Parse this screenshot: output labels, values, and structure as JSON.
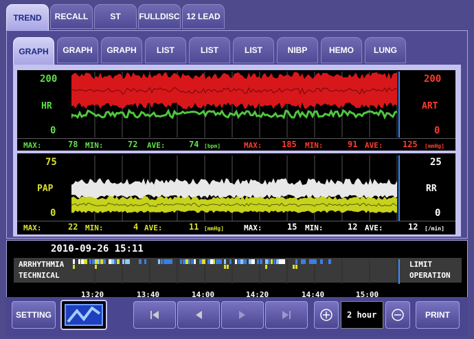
{
  "top_tabs": [
    "TREND",
    "RECALL",
    "ST",
    "FULLDISC",
    "12 LEAD"
  ],
  "sub_tabs": [
    "GRAPH",
    "GRAPH",
    "GRAPH",
    "LIST",
    "LIST",
    "LIST",
    "NIBP",
    "HEMO",
    "LUNG"
  ],
  "panel1": {
    "left_top": "200",
    "left_label": "HR",
    "left_bottom": "0",
    "right_top": "200",
    "right_label": "ART",
    "right_bottom": "0",
    "stats": {
      "max_label": "MAX:",
      "min_label": "MIN:",
      "ave_label": "AVE:",
      "hr_max": "78",
      "hr_min": "72",
      "hr_ave": "74",
      "hr_unit": "[bpm]",
      "art_max": "185",
      "art_min": "91",
      "art_ave": "125",
      "art_unit": "[mmHg]"
    }
  },
  "panel2": {
    "left_top": "75",
    "left_label": "PAP",
    "left_bottom": "0",
    "right_top": "25",
    "right_label": "RR",
    "right_bottom": "0",
    "stats": {
      "max_label": "MAX:",
      "min_label": "MIN:",
      "ave_label": "AVE:",
      "pap_max": "22",
      "pap_min": "4",
      "pap_ave": "11",
      "pap_unit": "[mmHg]",
      "rr_max": "15",
      "rr_min": "12",
      "rr_ave": "12",
      "rr_unit": "[/min]"
    }
  },
  "event": {
    "datetime": "2010-09-26 15:11",
    "left_line1": "ARRHYTHMIA",
    "left_line2": "TECHNICAL",
    "right_line1": "LIMIT",
    "right_line2": "OPERATION"
  },
  "time_ticks": [
    "13:20",
    "13:40",
    "14:00",
    "14:20",
    "14:40",
    "15:00"
  ],
  "bottom": {
    "setting": "SETTING",
    "range": "2 hour",
    "print": "PRINT",
    "icons": [
      "trend-wave-icon",
      "skip-first-icon",
      "step-back-icon",
      "step-forward-icon",
      "skip-last-icon",
      "zoom-in-icon",
      "zoom-out-icon"
    ]
  },
  "colors": {
    "hr": "#5ee049",
    "art": "#ff3b2e",
    "pap": "#d8e030",
    "rr": "#ffffff",
    "active_tab": "#c4c2f0",
    "background": "#4e4a8c",
    "cursor": "#3a8cff"
  }
}
